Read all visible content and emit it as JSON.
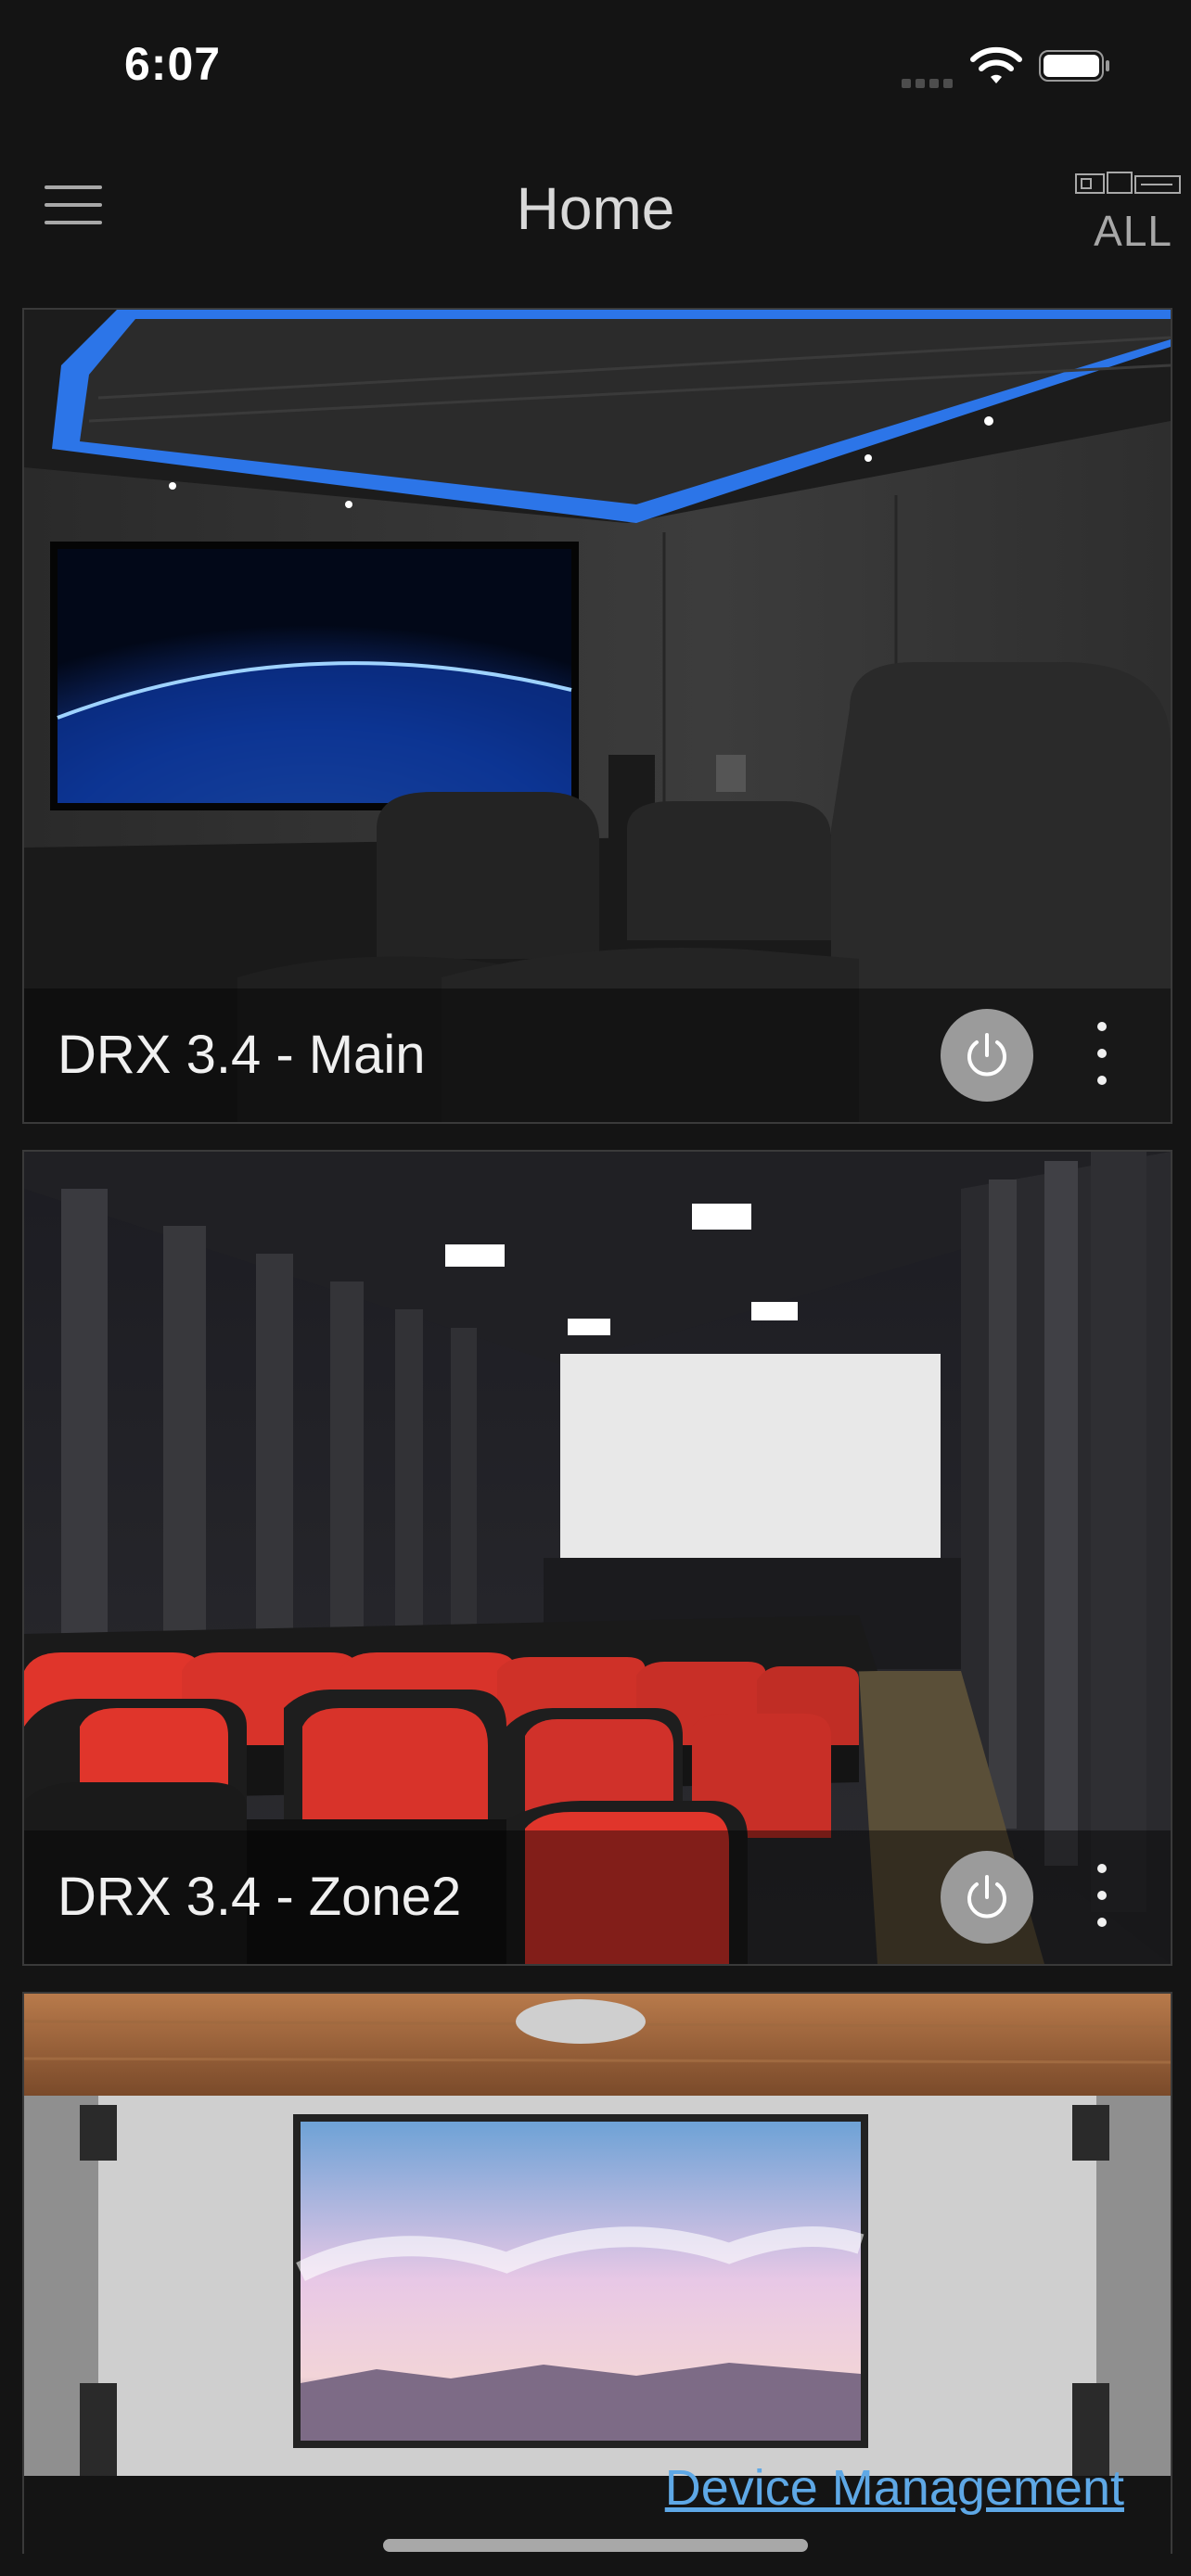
{
  "status_bar": {
    "time": "6:07"
  },
  "header": {
    "title": "Home",
    "menu_icon": "hamburger-icon",
    "zone_filter_label": "ALL",
    "zone_filter_icon": "receiver-icon"
  },
  "zones": [
    {
      "name": "DRX 3.4 - Main",
      "power_icon": "power-icon",
      "more_icon": "more-vertical-icon"
    },
    {
      "name": "DRX 3.4 - Zone2",
      "power_icon": "power-icon",
      "more_icon": "more-vertical-icon"
    }
  ],
  "footer": {
    "device_management_label": "Device Management"
  },
  "colors": {
    "background": "#141414",
    "link": "#5ea8e6",
    "power_button": "#9b9b9b",
    "accent_blue": "#2f7fff"
  }
}
